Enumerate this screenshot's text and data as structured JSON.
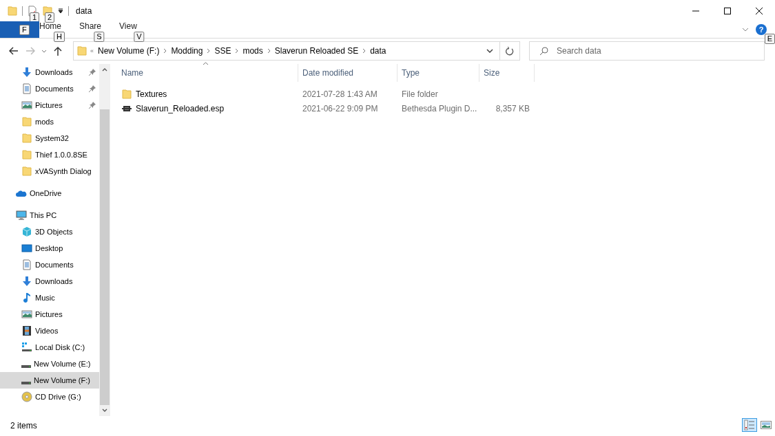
{
  "window": {
    "title": "data",
    "keytips": [
      "1",
      "2"
    ]
  },
  "ribbon": {
    "tabs": [
      {
        "keytip": "F",
        "kind": "file"
      },
      {
        "label": "Home",
        "keytip": "H",
        "kind": "tab"
      },
      {
        "label": "Share",
        "keytip": "S",
        "kind": "tab"
      },
      {
        "label": "View",
        "keytip": "V",
        "kind": "tab"
      }
    ],
    "help": "?",
    "help_keytip": "E"
  },
  "address": {
    "overflow": "«",
    "path": [
      "New Volume (F:)",
      "Modding",
      "SSE",
      "mods",
      "Slaverun Reloaded SE",
      "data"
    ]
  },
  "search": {
    "placeholder": "Search data"
  },
  "navigation": {
    "quick_access": [
      {
        "label": "Downloads",
        "kind": "download",
        "pinned": true,
        "selected": false
      },
      {
        "label": "Documents",
        "kind": "document",
        "pinned": true,
        "selected": false
      },
      {
        "label": "Pictures",
        "kind": "pictures",
        "pinned": true,
        "selected": false
      },
      {
        "label": "mods",
        "kind": "folder",
        "pinned": false,
        "selected": false
      },
      {
        "label": "System32",
        "kind": "folder",
        "pinned": false,
        "selected": false
      },
      {
        "label": "Thief 1.0.0.8SE",
        "kind": "folder",
        "pinned": false,
        "selected": false
      },
      {
        "label": "xVASynth Dialog",
        "kind": "folder",
        "pinned": false,
        "selected": false
      }
    ],
    "roots": [
      {
        "label": "OneDrive",
        "kind": "cloud",
        "selected": false
      },
      {
        "label": "This PC",
        "kind": "pc",
        "selected": false,
        "children": [
          {
            "label": "3D Objects",
            "kind": "cube",
            "selected": false
          },
          {
            "label": "Desktop",
            "kind": "desktop",
            "selected": false
          },
          {
            "label": "Documents",
            "kind": "document",
            "selected": false
          },
          {
            "label": "Downloads",
            "kind": "download",
            "selected": false
          },
          {
            "label": "Music",
            "kind": "music",
            "selected": false
          },
          {
            "label": "Pictures",
            "kind": "pictures",
            "selected": false
          },
          {
            "label": "Videos",
            "kind": "videos",
            "selected": false
          },
          {
            "label": "Local Disk (C:)",
            "kind": "windisk",
            "selected": false
          },
          {
            "label": "New Volume (E:)",
            "kind": "disk",
            "selected": false
          },
          {
            "label": "New Volume (F:)",
            "kind": "disk",
            "selected": true
          },
          {
            "label": "CD Drive (G:)",
            "kind": "cd",
            "selected": false
          }
        ]
      }
    ]
  },
  "table": {
    "columns": [
      "Name",
      "Date modified",
      "Type",
      "Size"
    ],
    "rows": [
      {
        "kind": "folder",
        "name": "Textures",
        "date": "2021-07-28 1:43 AM",
        "type": "File folder"
      },
      {
        "kind": "plugin",
        "name": "Slaverun_Reloaded.esp",
        "date": "2021-06-22 9:09 PM",
        "type": "Bethesda Plugin D...",
        "size": "8,357 KB"
      }
    ]
  },
  "status_bar": {
    "count": "2 items",
    "views": [
      {
        "kind": "details",
        "selected": true
      },
      {
        "kind": "thumbnails",
        "selected": false
      }
    ]
  }
}
